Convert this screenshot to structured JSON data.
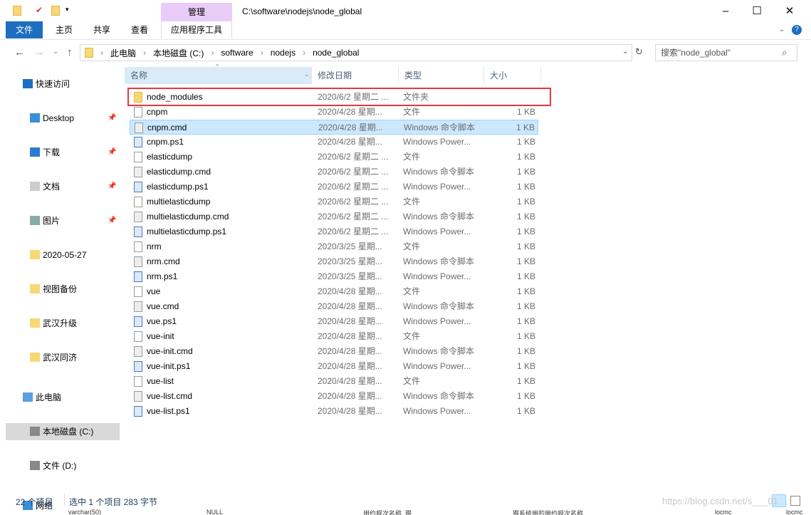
{
  "window": {
    "title": "C:\\software\\nodejs\\node_global",
    "manage_tab": "管理"
  },
  "ribbon": {
    "file": "文件",
    "home": "主页",
    "share": "共享",
    "view": "查看",
    "app_tools": "应用程序工具"
  },
  "breadcrumb": [
    "此电脑",
    "本地磁盘 (C:)",
    "software",
    "nodejs",
    "node_global"
  ],
  "search": {
    "placeholder": "搜索\"node_global\""
  },
  "sidebar": {
    "items": [
      {
        "label": "快速访问",
        "icon": "star-icon"
      },
      {
        "label": "Desktop",
        "icon": "desktop-icon",
        "pinned": true
      },
      {
        "label": "下载",
        "icon": "download-icon",
        "pinned": true
      },
      {
        "label": "文档",
        "icon": "document-icon",
        "pinned": true
      },
      {
        "label": "图片",
        "icon": "picture-icon",
        "pinned": true
      },
      {
        "label": "2020-05-27",
        "icon": "folder-icon"
      },
      {
        "label": "视图备份",
        "icon": "folder-icon"
      },
      {
        "label": "武汉升级",
        "icon": "folder-icon"
      },
      {
        "label": "武汉同济",
        "icon": "folder-icon"
      },
      {
        "label": "此电脑",
        "icon": "computer-icon"
      },
      {
        "label": "本地磁盘 (C:)",
        "icon": "drive-icon",
        "selected": true
      },
      {
        "label": "文件 (D:)",
        "icon": "drive-icon"
      },
      {
        "label": "网络",
        "icon": "network-icon"
      }
    ]
  },
  "columns": {
    "name": "名称",
    "date": "修改日期",
    "type": "类型",
    "size": "大小"
  },
  "files": [
    {
      "name": "node_modules",
      "date": "2020/6/2 星期二 ...",
      "type": "文件夹",
      "size": "",
      "kind": "fold"
    },
    {
      "name": "cnpm",
      "date": "2020/4/28 星期...",
      "type": "文件",
      "size": "1 KB",
      "kind": "file"
    },
    {
      "name": "cnpm.cmd",
      "date": "2020/4/28 星期...",
      "type": "Windows 命令脚本",
      "size": "1 KB",
      "kind": "cmd",
      "selected": true
    },
    {
      "name": "cnpm.ps1",
      "date": "2020/4/28 星期...",
      "type": "Windows Power...",
      "size": "1 KB",
      "kind": "ps"
    },
    {
      "name": "elasticdump",
      "date": "2020/6/2 星期二 ...",
      "type": "文件",
      "size": "1 KB",
      "kind": "file"
    },
    {
      "name": "elasticdump.cmd",
      "date": "2020/6/2 星期二 ...",
      "type": "Windows 命令脚本",
      "size": "1 KB",
      "kind": "cmd"
    },
    {
      "name": "elasticdump.ps1",
      "date": "2020/6/2 星期二 ...",
      "type": "Windows Power...",
      "size": "1 KB",
      "kind": "ps"
    },
    {
      "name": "multielasticdump",
      "date": "2020/6/2 星期二 ...",
      "type": "文件",
      "size": "1 KB",
      "kind": "file"
    },
    {
      "name": "multielasticdump.cmd",
      "date": "2020/6/2 星期二 ...",
      "type": "Windows 命令脚本",
      "size": "1 KB",
      "kind": "cmd"
    },
    {
      "name": "multielasticdump.ps1",
      "date": "2020/6/2 星期二 ...",
      "type": "Windows Power...",
      "size": "1 KB",
      "kind": "ps"
    },
    {
      "name": "nrm",
      "date": "2020/3/25 星期...",
      "type": "文件",
      "size": "1 KB",
      "kind": "file"
    },
    {
      "name": "nrm.cmd",
      "date": "2020/3/25 星期...",
      "type": "Windows 命令脚本",
      "size": "1 KB",
      "kind": "cmd"
    },
    {
      "name": "nrm.ps1",
      "date": "2020/3/25 星期...",
      "type": "Windows Power...",
      "size": "1 KB",
      "kind": "ps"
    },
    {
      "name": "vue",
      "date": "2020/4/28 星期...",
      "type": "文件",
      "size": "1 KB",
      "kind": "file"
    },
    {
      "name": "vue.cmd",
      "date": "2020/4/28 星期...",
      "type": "Windows 命令脚本",
      "size": "1 KB",
      "kind": "cmd"
    },
    {
      "name": "vue.ps1",
      "date": "2020/4/28 星期...",
      "type": "Windows Power...",
      "size": "1 KB",
      "kind": "ps"
    },
    {
      "name": "vue-init",
      "date": "2020/4/28 星期...",
      "type": "文件",
      "size": "1 KB",
      "kind": "file"
    },
    {
      "name": "vue-init.cmd",
      "date": "2020/4/28 星期...",
      "type": "Windows 命令脚本",
      "size": "1 KB",
      "kind": "cmd"
    },
    {
      "name": "vue-init.ps1",
      "date": "2020/4/28 星期...",
      "type": "Windows Power...",
      "size": "1 KB",
      "kind": "ps"
    },
    {
      "name": "vue-list",
      "date": "2020/4/28 星期...",
      "type": "文件",
      "size": "1 KB",
      "kind": "file"
    },
    {
      "name": "vue-list.cmd",
      "date": "2020/4/28 星期...",
      "type": "Windows 命令脚本",
      "size": "1 KB",
      "kind": "cmd"
    },
    {
      "name": "vue-list.ps1",
      "date": "2020/4/28 星期...",
      "type": "Windows Power...",
      "size": "1 KB",
      "kind": "ps"
    }
  ],
  "status": {
    "count": "22 个项目",
    "selection": "选中 1 个项目  283 字节"
  },
  "watermark": "https://blog.csdn.net/s___01",
  "background_text": [
    "varchar(50)",
    "NULL",
    "用约规次名称_跟",
    "跟系统用的用约规次名称",
    "locmc",
    "locmc"
  ]
}
